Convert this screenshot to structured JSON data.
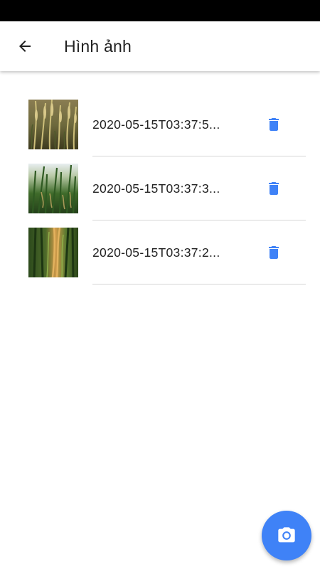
{
  "header": {
    "title": "Hình ảnh",
    "back_icon": "arrow-back-icon"
  },
  "images": [
    {
      "label": "2020-05-15T03:37:5...",
      "thumb": "rice-field-thumbnail-1",
      "delete_icon": "trash-icon"
    },
    {
      "label": "2020-05-15T03:37:3...",
      "thumb": "rice-field-thumbnail-2",
      "delete_icon": "trash-icon"
    },
    {
      "label": "2020-05-15T03:37:2...",
      "thumb": "rice-field-thumbnail-3",
      "delete_icon": "trash-icon"
    }
  ],
  "fab": {
    "icon": "camera-icon"
  },
  "colors": {
    "accent": "#3f82f7",
    "text": "#212121",
    "divider": "#d6d6d6",
    "status_bar": "#000000"
  }
}
